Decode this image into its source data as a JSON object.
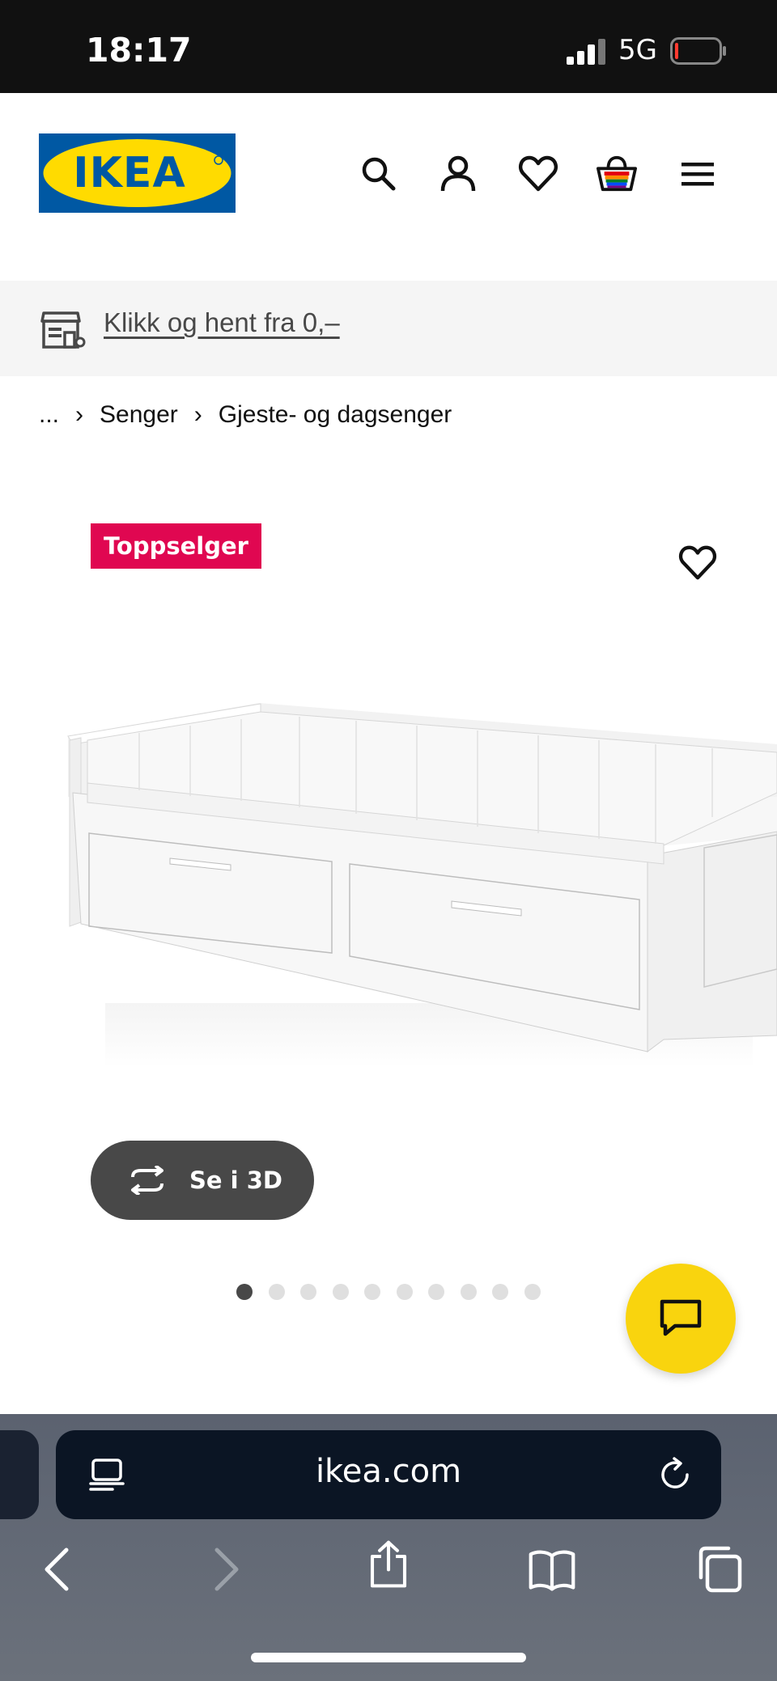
{
  "status_bar": {
    "time": "18:17",
    "network": "5G"
  },
  "header": {
    "logo_text": "IKEA",
    "icons": [
      "search-icon",
      "account-icon",
      "favourites-icon",
      "basket-icon",
      "menu-icon"
    ]
  },
  "promo": {
    "text": "Klikk og hent fra 0,–"
  },
  "breadcrumb": {
    "ellipsis": "...",
    "items": [
      "Senger",
      "Gjeste- og dagsenger"
    ]
  },
  "product": {
    "badge": "Toppselger",
    "view_3d_label": "Se i 3D",
    "image_count": 10,
    "active_image_index": 0
  },
  "browser": {
    "url": "ikea.com"
  },
  "colors": {
    "ikea_blue": "#0058a3",
    "ikea_yellow": "#ffdb00",
    "badge_red": "#e00751",
    "chat_yellow": "#f9d40e"
  }
}
